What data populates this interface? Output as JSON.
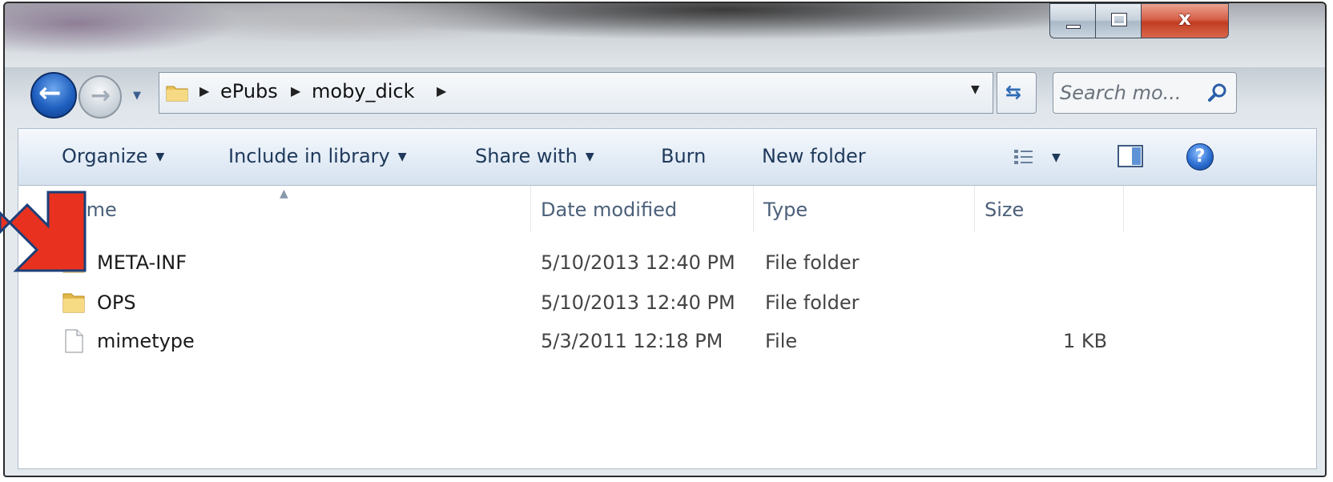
{
  "window": {
    "close_label": "x",
    "minimize_label": "",
    "maximize_label": ""
  },
  "address": {
    "crumbs": [
      "ePubs",
      "moby_dick"
    ]
  },
  "search": {
    "placeholder": "Search mo..."
  },
  "toolbar": {
    "organize": "Organize",
    "include_in_library": "Include in library",
    "share_with": "Share with",
    "burn": "Burn",
    "new_folder": "New folder",
    "help": "?"
  },
  "columns": {
    "name": "Name",
    "date_modified": "Date modified",
    "type": "Type",
    "size": "Size"
  },
  "files": [
    {
      "name": "META-INF",
      "date": "5/10/2013 12:40 PM",
      "type": "File folder",
      "size": "",
      "icon": "folder-icon"
    },
    {
      "name": "OPS",
      "date": "5/10/2013 12:40 PM",
      "type": "File folder",
      "size": "",
      "icon": "folder-icon"
    },
    {
      "name": "mimetype",
      "date": "5/3/2011 12:18 PM",
      "type": "File",
      "size": "1 KB",
      "icon": "file-icon"
    }
  ],
  "colors": {
    "toolbar_text": "#1e395b",
    "header_text": "#4c607a",
    "annotation_arrow": "#e8321f"
  }
}
